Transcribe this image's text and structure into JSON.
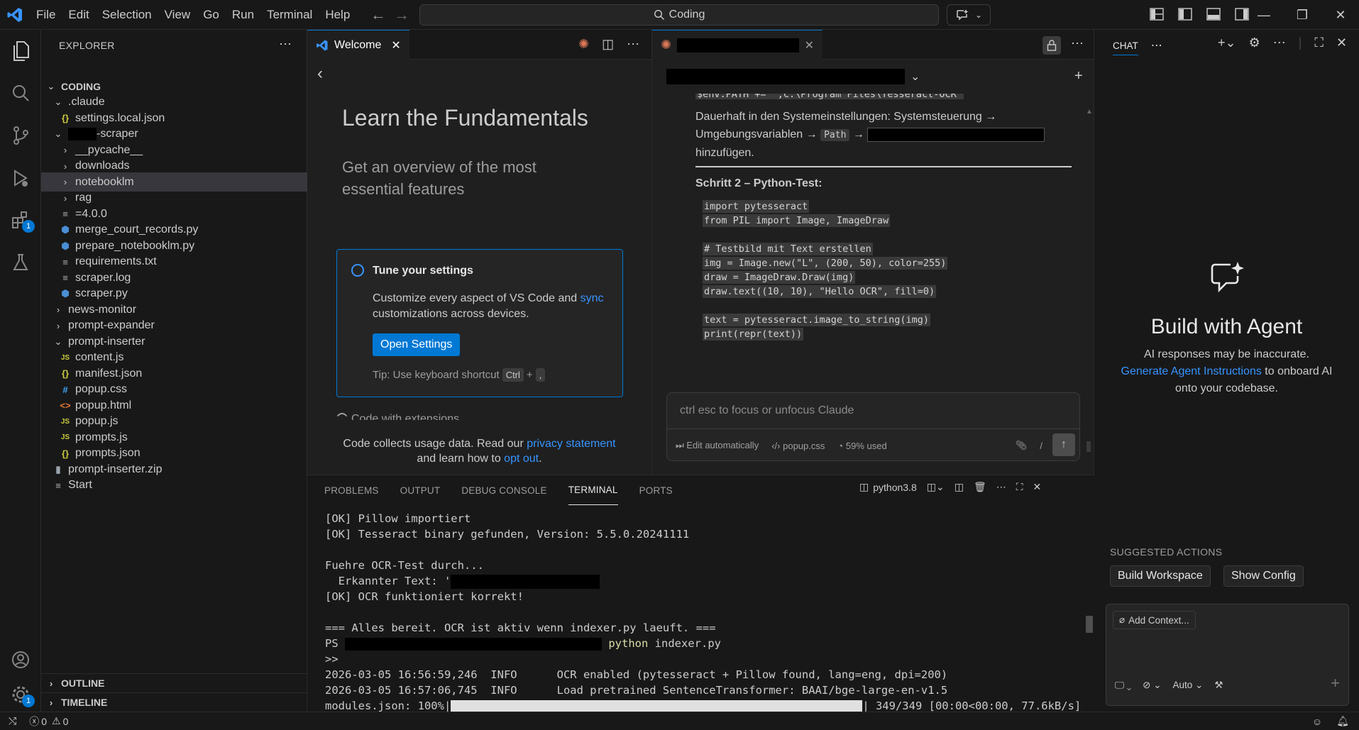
{
  "titlebar": {
    "menu": [
      "File",
      "Edit",
      "Selection",
      "View",
      "Go",
      "Run",
      "Terminal",
      "Help"
    ],
    "search": "Coding"
  },
  "explorer": {
    "header": "EXPLORER",
    "root": "CODING",
    "items": [
      {
        "label": ".claude",
        "type": "folder-open",
        "depth": 1
      },
      {
        "label": "settings.local.json",
        "type": "json",
        "depth": 2
      },
      {
        "label": "-scraper",
        "type": "folder-open",
        "depth": 1,
        "redacted_prefix": true
      },
      {
        "label": "__pycache__",
        "type": "folder",
        "depth": 2
      },
      {
        "label": "downloads",
        "type": "folder",
        "depth": 2
      },
      {
        "label": "notebooklm",
        "type": "folder",
        "depth": 2,
        "selected": true
      },
      {
        "label": "rag",
        "type": "folder",
        "depth": 2
      },
      {
        "label": "=4.0.0",
        "type": "text",
        "depth": 2
      },
      {
        "label": "merge_court_records.py",
        "type": "py",
        "depth": 2
      },
      {
        "label": "prepare_notebooklm.py",
        "type": "py",
        "depth": 2
      },
      {
        "label": "requirements.txt",
        "type": "text",
        "depth": 2
      },
      {
        "label": "scraper.log",
        "type": "text",
        "depth": 2
      },
      {
        "label": "scraper.py",
        "type": "py",
        "depth": 2
      },
      {
        "label": "news-monitor",
        "type": "folder",
        "depth": 1
      },
      {
        "label": "prompt-expander",
        "type": "folder",
        "depth": 1
      },
      {
        "label": "prompt-inserter",
        "type": "folder-open",
        "depth": 1
      },
      {
        "label": "content.js",
        "type": "js",
        "depth": 2
      },
      {
        "label": "manifest.json",
        "type": "json",
        "depth": 2
      },
      {
        "label": "popup.css",
        "type": "css",
        "depth": 2
      },
      {
        "label": "popup.html",
        "type": "html",
        "depth": 2
      },
      {
        "label": "popup.js",
        "type": "js",
        "depth": 2
      },
      {
        "label": "prompts.js",
        "type": "js",
        "depth": 2
      },
      {
        "label": "prompts.json",
        "type": "json",
        "depth": 2
      },
      {
        "label": "prompt-inserter.zip",
        "type": "zip",
        "depth": 1
      },
      {
        "label": "Start",
        "type": "text",
        "depth": 1
      }
    ],
    "outline": "OUTLINE",
    "timeline": "TIMELINE"
  },
  "activity": {
    "extensions_badge": "1",
    "settings_badge": "1"
  },
  "welcome": {
    "tab": "Welcome",
    "title": "Learn the Fundamentals",
    "subtitle": "Get an overview of the most essential features",
    "step_title": "Tune your settings",
    "step_desc_1": "Customize every aspect of VS Code and ",
    "step_desc_link": "sync",
    "step_desc_2": " customizations across devices.",
    "button": "Open Settings",
    "tip": "Tip: Use keyboard shortcut",
    "kbd1": "Ctrl",
    "plus": "+",
    "kbd2": ",",
    "next_step": "Code with extensions",
    "footer_1": "Code collects usage data. Read our ",
    "footer_link1": "privacy statement",
    "footer_2": "and learn how to ",
    "footer_link2": "opt out",
    "footer_3": "."
  },
  "claude": {
    "code_top": "$env:PATH += \";C:\\Program Files\\Tesseract-OCR\"",
    "para_1": "Dauerhaft in den Systemeinstellungen: Systemsteuerung → Umgebungsvariablen → ",
    "para_code": "Path",
    "para_arrow": " → ",
    "para_2": "hinzufügen.",
    "step_heading": "Schritt 2 – Python-Test:",
    "code_lines": [
      "import pytesseract",
      "from PIL import Image, ImageDraw",
      "",
      "# Testbild mit Text erstellen",
      "img = Image.new(\"L\", (200, 50), color=255)",
      "draw = ImageDraw.Draw(img)",
      "draw.text((10, 10), \"Hello OCR\", fill=0)",
      "",
      "text = pytesseract.image_to_string(img)",
      "print(repr(text))"
    ],
    "input_placeholder": "ctrl esc to focus or unfocus Claude",
    "mode": "Edit automatically",
    "file": "popup.css",
    "usage": "59% used"
  },
  "panel": {
    "tabs": [
      "PROBLEMS",
      "OUTPUT",
      "DEBUG CONSOLE",
      "TERMINAL",
      "PORTS"
    ],
    "active_tab": "TERMINAL",
    "shell": "python3.8"
  },
  "terminal": {
    "l1": "[OK] Pillow importiert",
    "l2": "[OK] Tesseract binary gefunden, Version: 5.5.0.20241111",
    "l3": "Fuehre OCR-Test durch...",
    "l4": "  Erkannter Text: '",
    "l5": "[OK] OCR funktioniert korrekt!",
    "l6": "=== Alles bereit. OCR ist aktiv wenn indexer.py laeuft. ===",
    "l7a": "PS ",
    "l7cmd": "python",
    "l7b": " indexer.py",
    "l8": ">>",
    "l9": "2026-03-05 16:56:59,246  INFO      OCR enabled (pytesseract + Pillow found, lang=eng, dpi=200)",
    "l10": "2026-03-05 16:57:06,745  INFO      Load pretrained SentenceTransformer: BAAI/bge-large-en-v1.5",
    "l11a": "modules.json: 100%|",
    "l11b": "| 349/349 [00:00<00:00, 77.6kB/s]",
    "progress": 1.0
  },
  "chat": {
    "header": "CHAT",
    "title": "Build with Agent",
    "disclaimer": "AI responses may be inaccurate.",
    "link": "Generate Agent Instructions",
    "onboard": " to onboard AI onto your codebase.",
    "suggested": "SUGGESTED ACTIONS",
    "action1": "Build Workspace",
    "action2": "Show Config",
    "add_context": "Add Context...",
    "model": "Auto"
  },
  "status": {
    "errors": "0",
    "warnings": "0"
  }
}
